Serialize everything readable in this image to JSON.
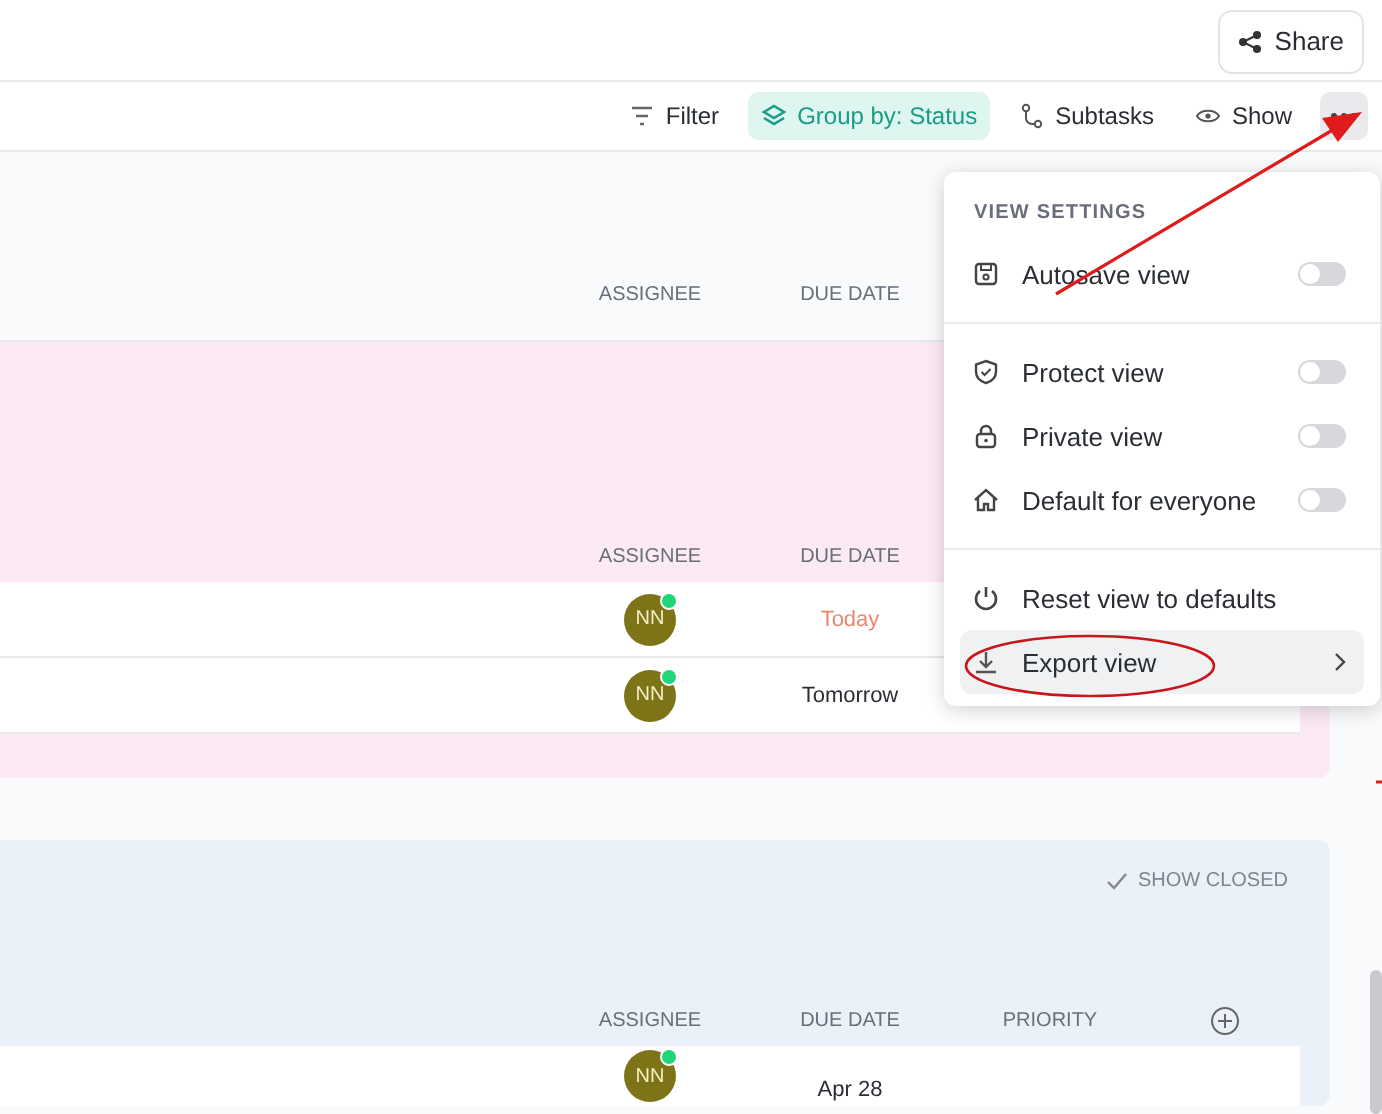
{
  "top_bar": {
    "share_button": "Share"
  },
  "toolbar": {
    "items": [
      {
        "label": "Filter",
        "active": false
      },
      {
        "label": "Group by: Status",
        "active": true
      },
      {
        "label": "Subtasks",
        "active": false
      },
      {
        "label": "Show",
        "active": false
      }
    ]
  },
  "groups": [
    {
      "color": "#f9fafc",
      "columns": [
        "ASSIGNEE",
        "DUE DATE"
      ]
    },
    {
      "color": "#fbeaf4",
      "columns": [
        "ASSIGNEE",
        "DUE DATE"
      ],
      "rows": [
        {
          "assignee": "NN",
          "online": true,
          "due": "Today",
          "due_highlight": true
        },
        {
          "assignee": "NN",
          "online": true,
          "due": "Tomorrow",
          "due_highlight": false
        }
      ]
    },
    {
      "color": "#ebf1f8",
      "show_closed": "SHOW CLOSED",
      "columns": [
        "ASSIGNEE",
        "DUE DATE",
        "PRIORITY"
      ],
      "rows": [
        {
          "assignee": "NN",
          "online": true,
          "due": "Apr 28",
          "due_highlight": false
        }
      ]
    }
  ],
  "menu": {
    "title": "VIEW SETTINGS",
    "sections": [
      {
        "items": [
          {
            "label": "Autosave view",
            "kind": "toggle",
            "on": false,
            "selected": false
          }
        ]
      },
      {
        "items": [
          {
            "label": "Protect view",
            "kind": "toggle",
            "on": false,
            "selected": false
          },
          {
            "label": "Private view",
            "kind": "toggle",
            "on": false,
            "selected": false
          },
          {
            "label": "Default for everyone",
            "kind": "toggle",
            "on": false,
            "selected": false
          }
        ]
      },
      {
        "items": [
          {
            "label": "Reset view to defaults",
            "kind": "action",
            "selected": false
          },
          {
            "label": "Export view",
            "kind": "submenu",
            "selected": true
          }
        ]
      }
    ]
  }
}
